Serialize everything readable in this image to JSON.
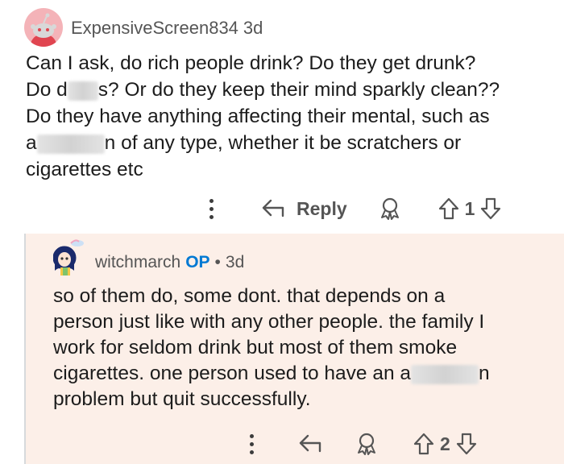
{
  "comments": [
    {
      "author": "ExpensiveScreen834",
      "time": "3d",
      "lines": [
        {
          "parts": [
            {
              "t": "Can I ask, do rich people drink? Do they get drunk?"
            }
          ]
        },
        {
          "parts": [
            {
              "t": "Do d"
            },
            {
              "blur": 38
            },
            {
              "t": "s? Or do they keep their mind sparkly clean??"
            }
          ]
        },
        {
          "parts": [
            {
              "t": "Do they have anything affecting their mental, such as"
            }
          ]
        },
        {
          "parts": [
            {
              "t": "a"
            },
            {
              "blur": 84
            },
            {
              "t": "n of any type, whether it be scratchers or"
            }
          ]
        },
        {
          "parts": [
            {
              "t": "cigarettes etc"
            }
          ]
        }
      ],
      "reply_label": "Reply",
      "vote_count": "1"
    },
    {
      "author": "witchmarch",
      "op_badge": "OP",
      "separator": "•",
      "time": "3d",
      "lines": [
        {
          "parts": [
            {
              "t": "so of them do, some dont. that depends on a"
            }
          ]
        },
        {
          "parts": [
            {
              "t": "person just like with any other people. the family I"
            }
          ]
        },
        {
          "parts": [
            {
              "t": "work for seldom drink but most of them smoke"
            }
          ]
        },
        {
          "parts": [
            {
              "t": "cigarettes. one person used to have an a"
            },
            {
              "blur": 84
            },
            {
              "t": "n"
            }
          ]
        },
        {
          "parts": [
            {
              "t": "problem but quit successfully."
            }
          ]
        }
      ],
      "vote_count": "2"
    }
  ],
  "colors": {
    "op": "#0079d3",
    "reply_bg": "#fcefe8",
    "avatar1_bg": "#f4b3b8"
  }
}
